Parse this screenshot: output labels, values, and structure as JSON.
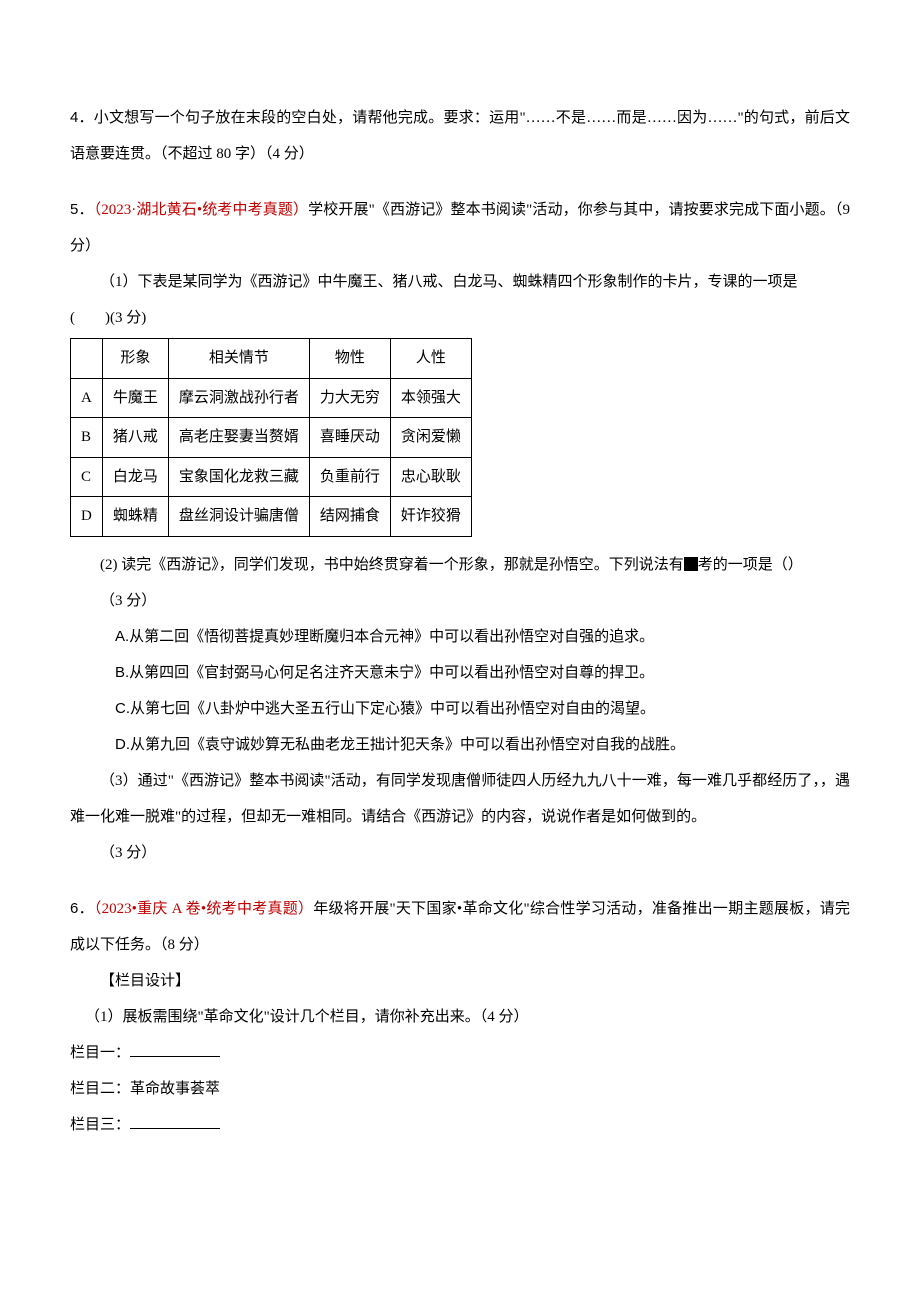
{
  "q4": {
    "num": "4．",
    "text": "小文想写一个句子放在末段的空白处，请帮他完成。要求：运用\"……不是……而是……因为……\"的句式，前后文语意要连贯。（不超过 80 字）（4 分）"
  },
  "q5": {
    "num": "5．",
    "source": "（2023·湖北黄石•统考中考真题）",
    "lead": "学校开展\"《西游记》整本书阅读\"活动，你参与其中，请按要求完成下面小题。（9 分）",
    "part1_intro": "（1）下表是某同学为《西游记》中牛魔王、猪八戒、白龙马、蜘蛛精四个形象制作的卡片，专课的一项是",
    "part1_tail": "(　　)(3 分)",
    "table": {
      "headers": [
        "",
        "形象",
        "相关情节",
        "物性",
        "人性"
      ],
      "rows": [
        [
          "A",
          "牛魔王",
          "摩云洞激战孙行者",
          "力大无穷",
          "本领强大"
        ],
        [
          "B",
          "猪八戒",
          "高老庄娶妻当赘婿",
          "喜睡厌动",
          "贪闲爱懒"
        ],
        [
          "C",
          "白龙马",
          "宝象国化龙救三藏",
          "负重前行",
          "忠心耿耿"
        ],
        [
          "D",
          "蜘蛛精",
          "盘丝洞设计骗唐僧",
          "结网捕食",
          "奸诈狡猾"
        ]
      ]
    },
    "part2_lead": "(2) 读完《西游记》，同学们发现，书中始终贯穿着一个形象，那就是孙悟空。下列说法有",
    "part2_tail": "考的一项是（）",
    "part2_points": "（3 分）",
    "options": [
      "A.从第二回《悟彻菩提真妙理断魔归本合元神》中可以看出孙悟空对自强的追求。",
      "B.从第四回《官封弼马心何足名注齐天意未宁》中可以看出孙悟空对自尊的捍卫。",
      "C.从第七回《八卦炉中逃大圣五行山下定心猿》中可以看出孙悟空对自由的渴望。",
      "D.从第九回《袁守诚妙算无私曲老龙王拙计犯天条》中可以看出孙悟空对自我的战胜。"
    ],
    "part3_a": "（3）通过\"《西游记》整本书阅读\"活动，有同学发现唐僧师徒四人历经九九八十一难，每一难几乎都经历了，，遇难一化难一脱难\"的过程，但却无一难相同。请结合《西游记》的内容，说说作者是如何做到的。",
    "part3_points": "（3 分）"
  },
  "q6": {
    "num": "6．",
    "source": "（2023•重庆 A 卷•统考中考真题）",
    "lead": "年级将开展\"天下国家•革命文化\"综合性学习活动，准备推出一期主题展板，请完成以下任务。（8 分）",
    "label": "【栏目设计】",
    "part1": "（1）展板需围绕\"革命文化\"设计几个栏目，请你补充出来。（4 分）",
    "col1_label": "栏目一：",
    "col2_label": "栏目二：",
    "col2_value": "革命故事荟萃",
    "col3_label": "栏目三："
  }
}
